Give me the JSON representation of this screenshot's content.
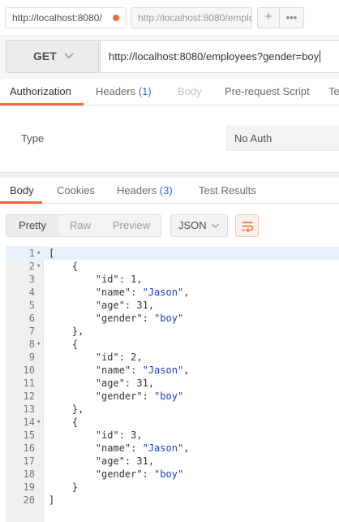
{
  "request_tabs": [
    {
      "label": "http://localhost:8080/",
      "active": true,
      "unsaved": true
    },
    {
      "label": "http://localhost:8080/emplo",
      "active": false
    }
  ],
  "tab_actions": {
    "new_tab": "+",
    "more": "•••"
  },
  "request": {
    "method": "GET",
    "url": "http://localhost:8080/employees?gender=boy"
  },
  "request_subtabs": {
    "authorization": "Authorization",
    "headers": "Headers",
    "headers_count": "(1)",
    "body": "Body",
    "prerequest": "Pre-request Script",
    "tests": "Te"
  },
  "auth": {
    "type_label": "Type",
    "type_value": "No Auth"
  },
  "response_tabs": {
    "body": "Body",
    "cookies": "Cookies",
    "headers": "Headers",
    "headers_count": "(3)",
    "test_results": "Test Results"
  },
  "response_toolbar": {
    "pretty": "Pretty",
    "raw": "Raw",
    "preview": "Preview",
    "format": "JSON"
  },
  "colors": {
    "accent": "#f26b3a",
    "count_blue": "#2a6bd8",
    "string_blue": "#1a3fbf"
  },
  "code_lines": [
    {
      "n": "1",
      "fold": true,
      "text": "["
    },
    {
      "n": "2",
      "fold": true,
      "text": "    {"
    },
    {
      "n": "3",
      "text": "        \"id\": 1,"
    },
    {
      "n": "4",
      "text": "        \"name\": \"Jason\","
    },
    {
      "n": "5",
      "text": "        \"age\": 31,"
    },
    {
      "n": "6",
      "text": "        \"gender\": \"boy\""
    },
    {
      "n": "7",
      "text": "    },"
    },
    {
      "n": "8",
      "fold": true,
      "text": "    {"
    },
    {
      "n": "9",
      "text": "        \"id\": 2,"
    },
    {
      "n": "10",
      "text": "        \"name\": \"Jason\","
    },
    {
      "n": "11",
      "text": "        \"age\": 31,"
    },
    {
      "n": "12",
      "text": "        \"gender\": \"boy\""
    },
    {
      "n": "13",
      "text": "    },"
    },
    {
      "n": "14",
      "fold": true,
      "text": "    {"
    },
    {
      "n": "15",
      "text": "        \"id\": 3,"
    },
    {
      "n": "16",
      "text": "        \"name\": \"Jason\","
    },
    {
      "n": "17",
      "text": "        \"age\": 31,"
    },
    {
      "n": "18",
      "text": "        \"gender\": \"boy\""
    },
    {
      "n": "19",
      "text": "    }"
    },
    {
      "n": "20",
      "text": "]"
    }
  ]
}
